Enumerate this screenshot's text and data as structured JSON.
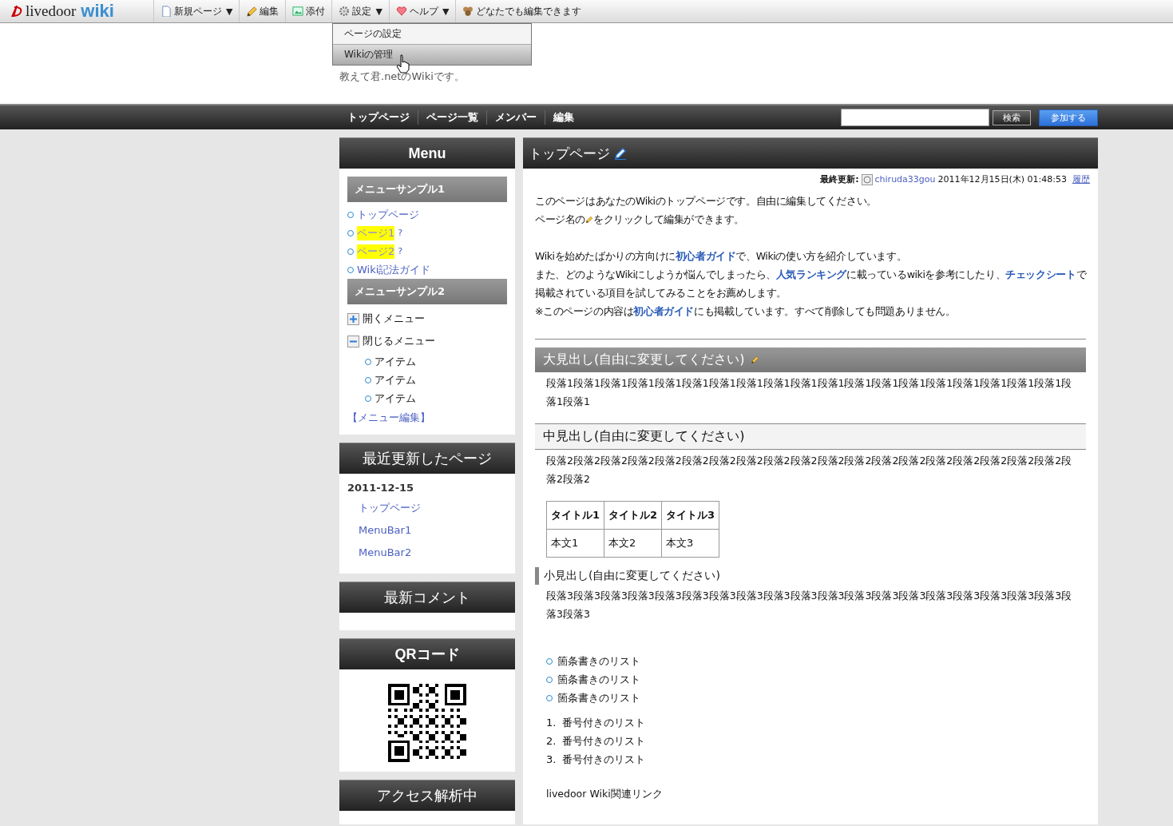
{
  "toolbar": {
    "logo": {
      "brand": "livedoor",
      "product": "wiki"
    },
    "items": [
      {
        "label": "新規ページ",
        "dropdown": true
      },
      {
        "label": "編集",
        "dropdown": false
      },
      {
        "label": "添付",
        "dropdown": false
      },
      {
        "label": "設定",
        "dropdown": true
      },
      {
        "label": "ヘルプ",
        "dropdown": true
      },
      {
        "label": "どなたでも編集できます",
        "dropdown": false
      }
    ],
    "dropdown_caret": "▼",
    "menu": [
      {
        "label": "ページの設定",
        "selected": false
      },
      {
        "label": "Wikiの管理",
        "selected": true
      }
    ]
  },
  "header": {
    "description": "教えて君.netのWikiです。"
  },
  "nav": {
    "links": [
      "トップページ",
      "ページ一覧",
      "メンバー",
      "編集"
    ],
    "search_button": "検索",
    "join_button": "参加する"
  },
  "sidebar": [
    {
      "kind": "menu",
      "title": "Menu",
      "sections": [
        {
          "title": "メニューサンプル1",
          "links": [
            {
              "text": "トップページ",
              "missing": false
            },
            {
              "text": "ページ1",
              "missing": true,
              "suffix": "?"
            },
            {
              "text": "ページ2",
              "missing": true,
              "suffix": "?"
            },
            {
              "text": "Wiki記法ガイド",
              "missing": false
            }
          ]
        },
        {
          "title": "メニューサンプル2",
          "tree": [
            {
              "label": "開くメニュー",
              "expanded": false
            },
            {
              "label": "閉じるメニュー",
              "expanded": true,
              "children": [
                {
                  "label": "アイテム"
                },
                {
                  "label": "アイテム"
                },
                {
                  "label": "アイテム"
                }
              ]
            }
          ]
        }
      ],
      "edit_link": "【メニュー編集】"
    },
    {
      "kind": "recent",
      "title": "最近更新したページ",
      "date": "2011-12-15",
      "links": [
        "トップページ",
        "MenuBar1",
        "MenuBar2"
      ]
    },
    {
      "kind": "comments",
      "title": "最新コメント"
    },
    {
      "kind": "qr",
      "title": "QRコード"
    },
    {
      "kind": "access",
      "title": "アクセス解析中"
    }
  ],
  "page": {
    "title": "トップページ",
    "updated": {
      "label": "最終更新:",
      "user": "chiruda33gou",
      "date": "2011年12月15日(木) 01:48:53",
      "history": "履歴"
    },
    "blocks": [
      {
        "kind": "para",
        "lines": [
          [
            {
              "kind": "text",
              "v": "このページはあなたのWikiのトップページです。自由に編集してください。"
            }
          ],
          [
            {
              "kind": "text",
              "v": "ページ名の"
            },
            {
              "kind": "pencil"
            },
            {
              "kind": "text",
              "v": "をクリックして編集ができます。"
            }
          ]
        ]
      },
      {
        "kind": "para",
        "lines": [
          [
            {
              "kind": "text",
              "v": "Wikiを始めたばかりの方向けに"
            },
            {
              "kind": "link",
              "v": "初心者ガイド"
            },
            {
              "kind": "text",
              "v": "で、Wikiの使い方を紹介しています。"
            }
          ],
          [
            {
              "kind": "text",
              "v": "また、どのようなWikiにしようか悩んでしまったら、"
            },
            {
              "kind": "link",
              "v": "人気ランキング"
            },
            {
              "kind": "text",
              "v": "に載っているwikiを参考にしたり、"
            },
            {
              "kind": "link",
              "v": "チェックシート"
            },
            {
              "kind": "text",
              "v": "で"
            }
          ],
          [
            {
              "kind": "text",
              "v": "掲載されている項目を試してみることをお薦めします。"
            }
          ],
          [
            {
              "kind": "text",
              "v": "※このページの内容は"
            },
            {
              "kind": "link",
              "v": "初心者ガイド"
            },
            {
              "kind": "text",
              "v": "にも掲載しています。すべて削除しても問題ありません。"
            }
          ]
        ]
      },
      {
        "kind": "rule"
      },
      {
        "kind": "h2",
        "text": "大見出し(自由に変更してください)"
      },
      {
        "kind": "text",
        "text": "段落1段落1段落1段落1段落1段落1段落1段落1段落1段落1段落1段落1段落1段落1段落1段落1段落1段落1段落1段落1段落1"
      },
      {
        "kind": "h3",
        "text": "中見出し(自由に変更してください)"
      },
      {
        "kind": "text",
        "text": "段落2段落2段落2段落2段落2段落2段落2段落2段落2段落2段落2段落2段落2段落2段落2段落2段落2段落2段落2段落2段落2"
      },
      {
        "kind": "table",
        "columns": [
          "タイトル1",
          "タイトル2",
          "タイトル3"
        ],
        "rows": [
          [
            "本文1",
            "本文2",
            "本文3"
          ]
        ]
      },
      {
        "kind": "h4",
        "text": "小見出し(自由に変更してください)"
      },
      {
        "kind": "text",
        "text": "段落3段落3段落3段落3段落3段落3段落3段落3段落3段落3段落3段落3段落3段落3段落3段落3段落3段落3段落3段落3段落3"
      },
      {
        "kind": "ul",
        "items": [
          "箇条書きのリスト",
          "箇条書きのリスト",
          "箇条書きのリスト"
        ]
      },
      {
        "kind": "ol",
        "items": [
          {
            "num": "1.",
            "text": "番号付きのリスト"
          },
          {
            "num": "2.",
            "text": "番号付きのリスト"
          },
          {
            "num": "3.",
            "text": "番号付きのリスト"
          }
        ]
      },
      {
        "kind": "text",
        "text": "livedoor Wiki関連リンク"
      }
    ]
  }
}
